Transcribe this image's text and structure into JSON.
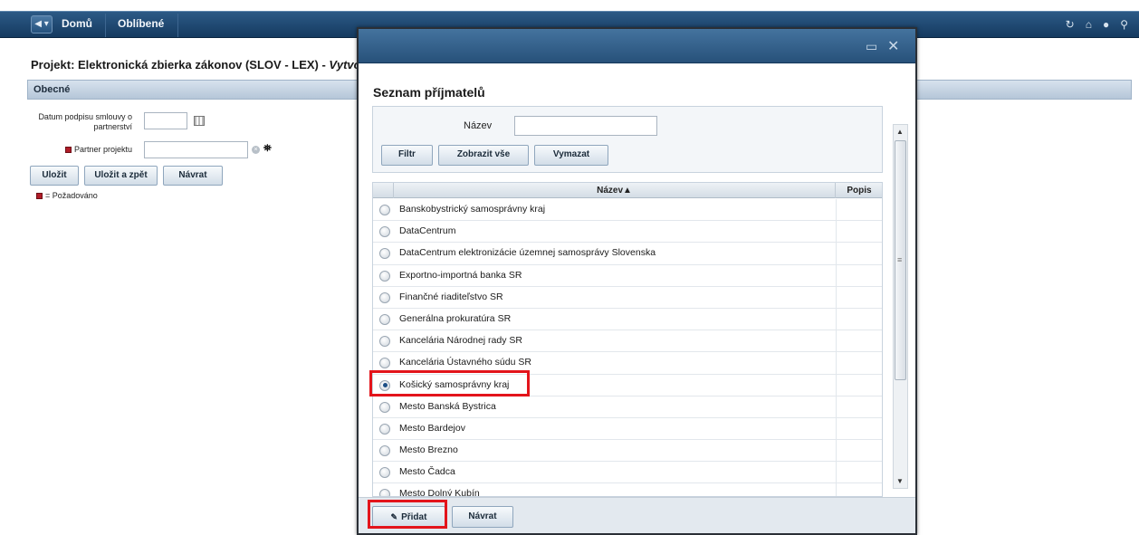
{
  "topnav": {
    "back_label": "◀ ▾",
    "items": [
      "Domů",
      "Oblíbené"
    ],
    "right_icons": [
      "refresh-icon",
      "home-icon",
      "settings-icon",
      "search-icon"
    ]
  },
  "page": {
    "title_main": "Projekt: Elektronická zbierka zákonov (SLOV - LEX) - ",
    "title_italic": "Vytvoři",
    "section": "Obecné",
    "fields": {
      "date_label": "Datum podpisu smlouvy o partnerství",
      "partner_label": "Partner projektu"
    },
    "buttons": {
      "save": "Uložit",
      "save_back": "Uložit a zpět",
      "return": "Návrat"
    },
    "legend": "= Požadováno"
  },
  "modal": {
    "title": "Seznam příjmatelů",
    "filter": {
      "name_label": "Název",
      "name_value": "",
      "filter_btn": "Filtr",
      "show_all_btn": "Zobrazit vše",
      "clear_btn": "Vymazat"
    },
    "grid": {
      "col_name": "Název▲",
      "col_desc": "Popis",
      "rows": [
        "Banskobystrický samosprávny kraj",
        "DataCentrum",
        "DataCentrum elektronizácie územnej samosprávy Slovenska",
        "Exportno-importná banka SR",
        "Finančné riaditeľstvo SR",
        "Generálna prokuratúra SR",
        "Kancelária Národnej rady SR",
        "Kancelária Ústavného súdu SR",
        "Košický samosprávny kraj",
        "Mesto Banská Bystrica",
        "Mesto Bardejov",
        "Mesto Brezno",
        "Mesto Čadca",
        "Mesto Dolný Kubín"
      ],
      "selected": "Košický samosprávny kraj"
    },
    "footer": {
      "add_btn": "Přidat",
      "return_btn": "Návrat"
    }
  },
  "colors": {
    "highlight": "#e3141b",
    "nav": "#1f4a74",
    "required": "#b01c28"
  }
}
